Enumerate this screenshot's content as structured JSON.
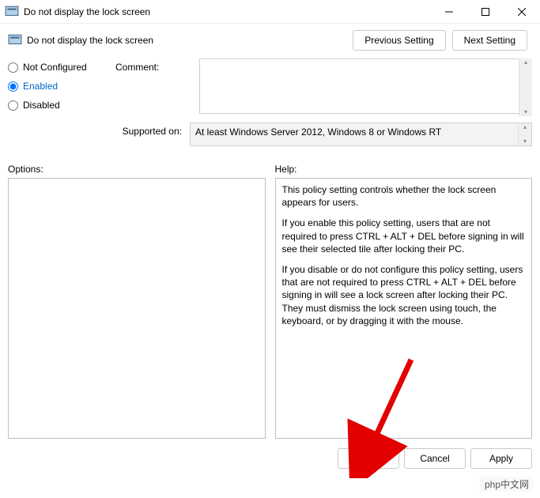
{
  "window": {
    "title": "Do not display the lock screen"
  },
  "header": {
    "subtitle": "Do not display the lock screen",
    "prev_label": "Previous Setting",
    "next_label": "Next Setting"
  },
  "radios": {
    "not_configured": "Not Configured",
    "enabled": "Enabled",
    "disabled": "Disabled",
    "selected": "enabled"
  },
  "labels": {
    "comment": "Comment:",
    "supported_on": "Supported on:",
    "options": "Options:",
    "help": "Help:"
  },
  "supported_text": "At least Windows Server 2012, Windows 8 or Windows RT",
  "help_text": {
    "p1": "This policy setting controls whether the lock screen appears for users.",
    "p2": "If you enable this policy setting, users that are not required to press CTRL + ALT + DEL before signing in will see their selected tile after locking their PC.",
    "p3": "If you disable or do not configure this policy setting, users that are not required to press CTRL + ALT + DEL before signing in will see a lock screen after locking their PC. They must dismiss the lock screen using touch, the keyboard, or by dragging it with the mouse."
  },
  "buttons": {
    "ok": "OK",
    "cancel": "Cancel",
    "apply": "Apply"
  },
  "watermark": "php中文网"
}
